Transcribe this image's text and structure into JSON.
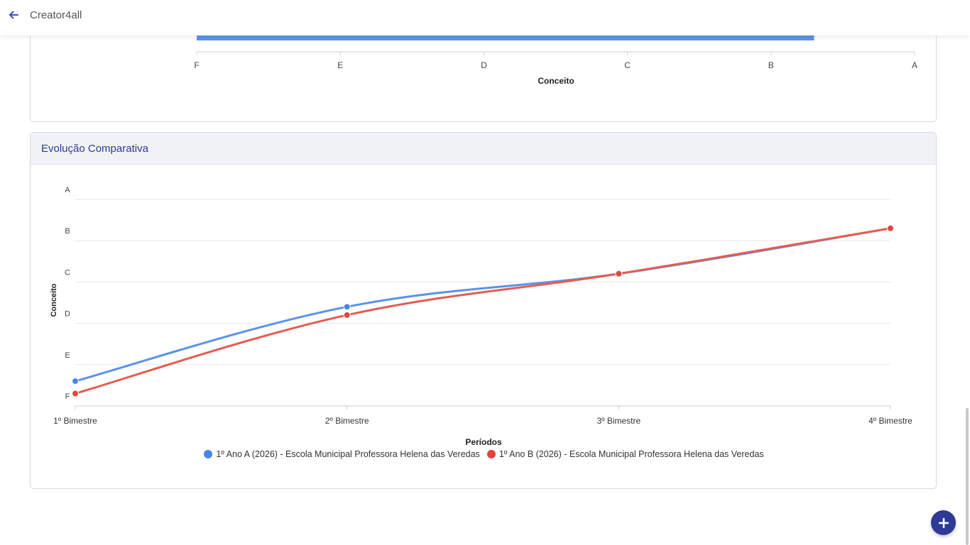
{
  "header": {
    "app_title": "Creator4all"
  },
  "top_chart": {
    "xlabel": "Conceito",
    "ticks": [
      "F",
      "E",
      "D",
      "C",
      "B",
      "A"
    ],
    "bar_value": 4.3
  },
  "comparative": {
    "title": "Evolução Comparativa"
  },
  "chart_data": {
    "type": "line",
    "title": "",
    "xlabel": "Períodos",
    "ylabel": "Conceito",
    "categories": [
      "1º Bimestre",
      "2º Bimestre",
      "3º Bimestre",
      "4º Bimestre"
    ],
    "y_ticks": [
      "F",
      "E",
      "D",
      "C",
      "B",
      "A"
    ],
    "ylim": [
      0,
      5
    ],
    "grid": true,
    "legend": "bottom",
    "series": [
      {
        "name": "1º Ano A (2026) - Escola Municipal Professora Helena das Veredas",
        "color": "#5b93e8",
        "dot_color": "#4a84e8",
        "values": [
          0.6,
          2.4,
          3.2,
          4.3
        ]
      },
      {
        "name": "1º Ano B (2026) - Escola Municipal Professora Helena das Veredas",
        "color": "#e35d50",
        "dot_color": "#e2463c",
        "values": [
          0.3,
          2.2,
          3.2,
          4.3
        ]
      }
    ]
  }
}
